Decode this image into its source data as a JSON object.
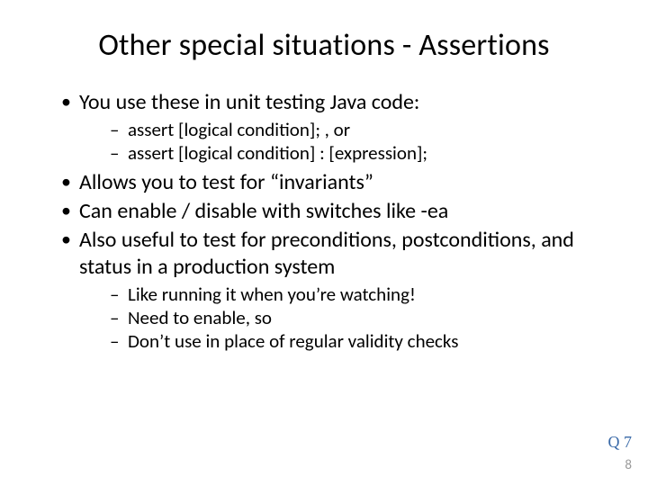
{
  "title": "Other special situations - Assertions",
  "bullets": {
    "b1": "You use these in unit testing Java code:",
    "b1s1": "assert [logical condition]; , or",
    "b1s2": "assert [logical condition] : [expression];",
    "b2": "Allows you to test for “invariants”",
    "b3": "Can enable / disable with switches like -ea",
    "b4": "Also useful to test for preconditions, postconditions, and status in a production system",
    "b4s1": "Like running it when you’re watching!",
    "b4s2": "Need to enable, so",
    "b4s3": "Don’t use in place of regular validity checks"
  },
  "qref": "Q 7",
  "pagenum": "8"
}
